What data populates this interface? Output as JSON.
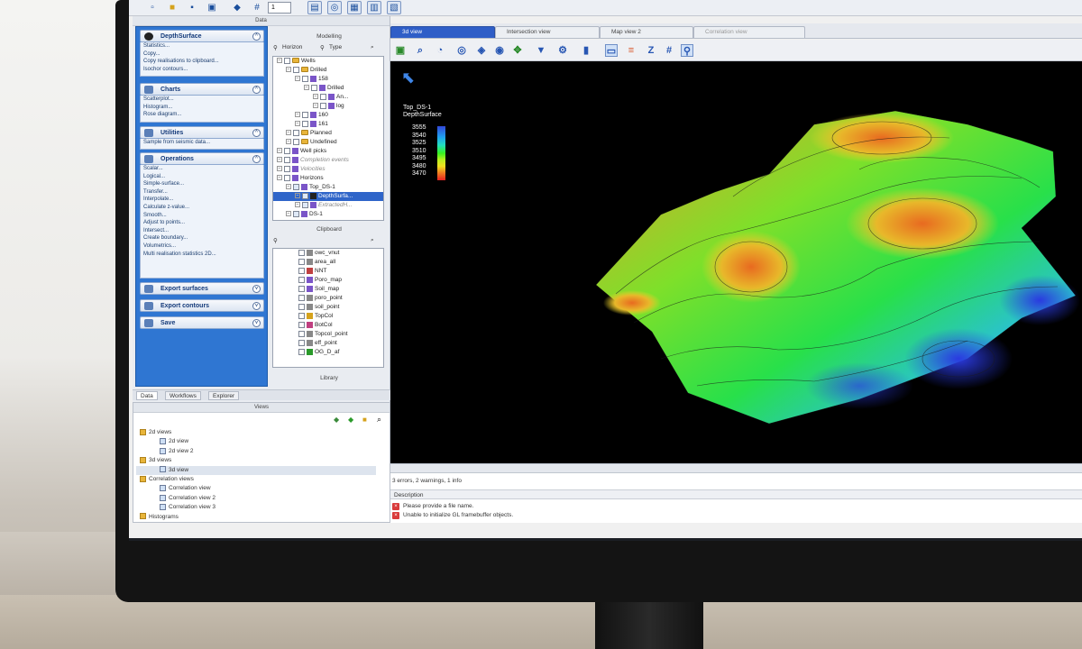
{
  "toolbar": {
    "spinner_value": "1"
  },
  "data_pane": {
    "title": "Data"
  },
  "processes": {
    "sections": [
      {
        "name": "DepthSurface",
        "items": [
          "Statistics...",
          "Copy...",
          "Copy realisations to clipboard...",
          "Isochor contours..."
        ]
      },
      {
        "name": "Charts",
        "items": [
          "Scatterplot...",
          "Histogram...",
          "Rose diagram..."
        ]
      },
      {
        "name": "Utilities",
        "items": [
          "Sample from seismic data..."
        ]
      },
      {
        "name": "Operations",
        "items": [
          "Scalar...",
          "Logical...",
          "Simple-surface...",
          "Transfer...",
          "Interpolate...",
          "Calculate z-value...",
          "Smooth...",
          "Adjust to points...",
          "Intersect...",
          "Create boundary...",
          "Volumetrics...",
          "Multi realisation statistics 2D..."
        ]
      },
      {
        "name": "Export surfaces",
        "items": []
      },
      {
        "name": "Export contours",
        "items": []
      },
      {
        "name": "Save",
        "items": []
      }
    ]
  },
  "modelling": {
    "title": "Modelling",
    "filter_horizon": "Horizon",
    "filter_type": "Type",
    "tree": [
      {
        "label": "Wells",
        "depth": 0,
        "kind": "folder"
      },
      {
        "label": "Drilled",
        "depth": 1,
        "kind": "folder"
      },
      {
        "label": "158",
        "depth": 2,
        "kind": "item"
      },
      {
        "label": "Drilled",
        "depth": 3,
        "kind": "item"
      },
      {
        "label": "An...",
        "depth": 4,
        "kind": "item"
      },
      {
        "label": "log",
        "depth": 4,
        "kind": "item"
      },
      {
        "label": "160",
        "depth": 2,
        "kind": "item"
      },
      {
        "label": "161",
        "depth": 2,
        "kind": "item"
      },
      {
        "label": "Planned",
        "depth": 1,
        "kind": "folder"
      },
      {
        "label": "Undefined",
        "depth": 1,
        "kind": "folder"
      },
      {
        "label": "Well picks",
        "depth": 0,
        "kind": "item"
      },
      {
        "label": "Completion events",
        "depth": 0,
        "kind": "muted"
      },
      {
        "label": "Velocities",
        "depth": 0,
        "kind": "muted"
      },
      {
        "label": "Horizons",
        "depth": 0,
        "kind": "item"
      },
      {
        "label": "Top_DS-1",
        "depth": 1,
        "kind": "item"
      },
      {
        "label": "DepthSurfa...",
        "depth": 2,
        "kind": "selected"
      },
      {
        "label": "ExtractedH...",
        "depth": 2,
        "kind": "muted"
      },
      {
        "label": "DS-1",
        "depth": 1,
        "kind": "item"
      }
    ]
  },
  "clipboard": {
    "title": "Clipboard",
    "items": [
      "owc_vnut",
      "area_all",
      "NNT",
      "Poro_map",
      "Soil_map",
      "poro_point",
      "soil_point",
      "TopCol",
      "BotCol",
      "Topcol_point",
      "eff_point",
      "OG_D_af"
    ]
  },
  "library": {
    "title": "Library"
  },
  "side_tabs": [
    "Data",
    "Workflows",
    "Explorer"
  ],
  "views_pane": {
    "title": "Views",
    "tree": [
      {
        "label": "2d views",
        "depth": 0
      },
      {
        "label": "2d view",
        "depth": 1
      },
      {
        "label": "2d view 2",
        "depth": 1
      },
      {
        "label": "3d views",
        "depth": 0
      },
      {
        "label": "3d view",
        "depth": 1
      },
      {
        "label": "Correlation views",
        "depth": 0
      },
      {
        "label": "Correlation view",
        "depth": 1
      },
      {
        "label": "Correlation view 2",
        "depth": 1
      },
      {
        "label": "Correlation view 3",
        "depth": 1
      },
      {
        "label": "Histograms",
        "depth": 0
      }
    ]
  },
  "view_tabs": [
    "3d view",
    "Intersection view",
    "Map view 2",
    "Correlation view"
  ],
  "legend": {
    "title": "Top_DS-1",
    "subtitle": "DepthSurface",
    "values": [
      "3555",
      "3540",
      "3525",
      "3510",
      "3495",
      "3480",
      "3470"
    ]
  },
  "messages": {
    "summary": "3 errors, 2 warnings, 1 info",
    "header": "Description",
    "rows": [
      "Please provide a file name.",
      "Unable to initialize GL framebuffer objects."
    ]
  },
  "colors": {
    "accent": "#2f65c9",
    "process_panel": "#2f76d2"
  }
}
